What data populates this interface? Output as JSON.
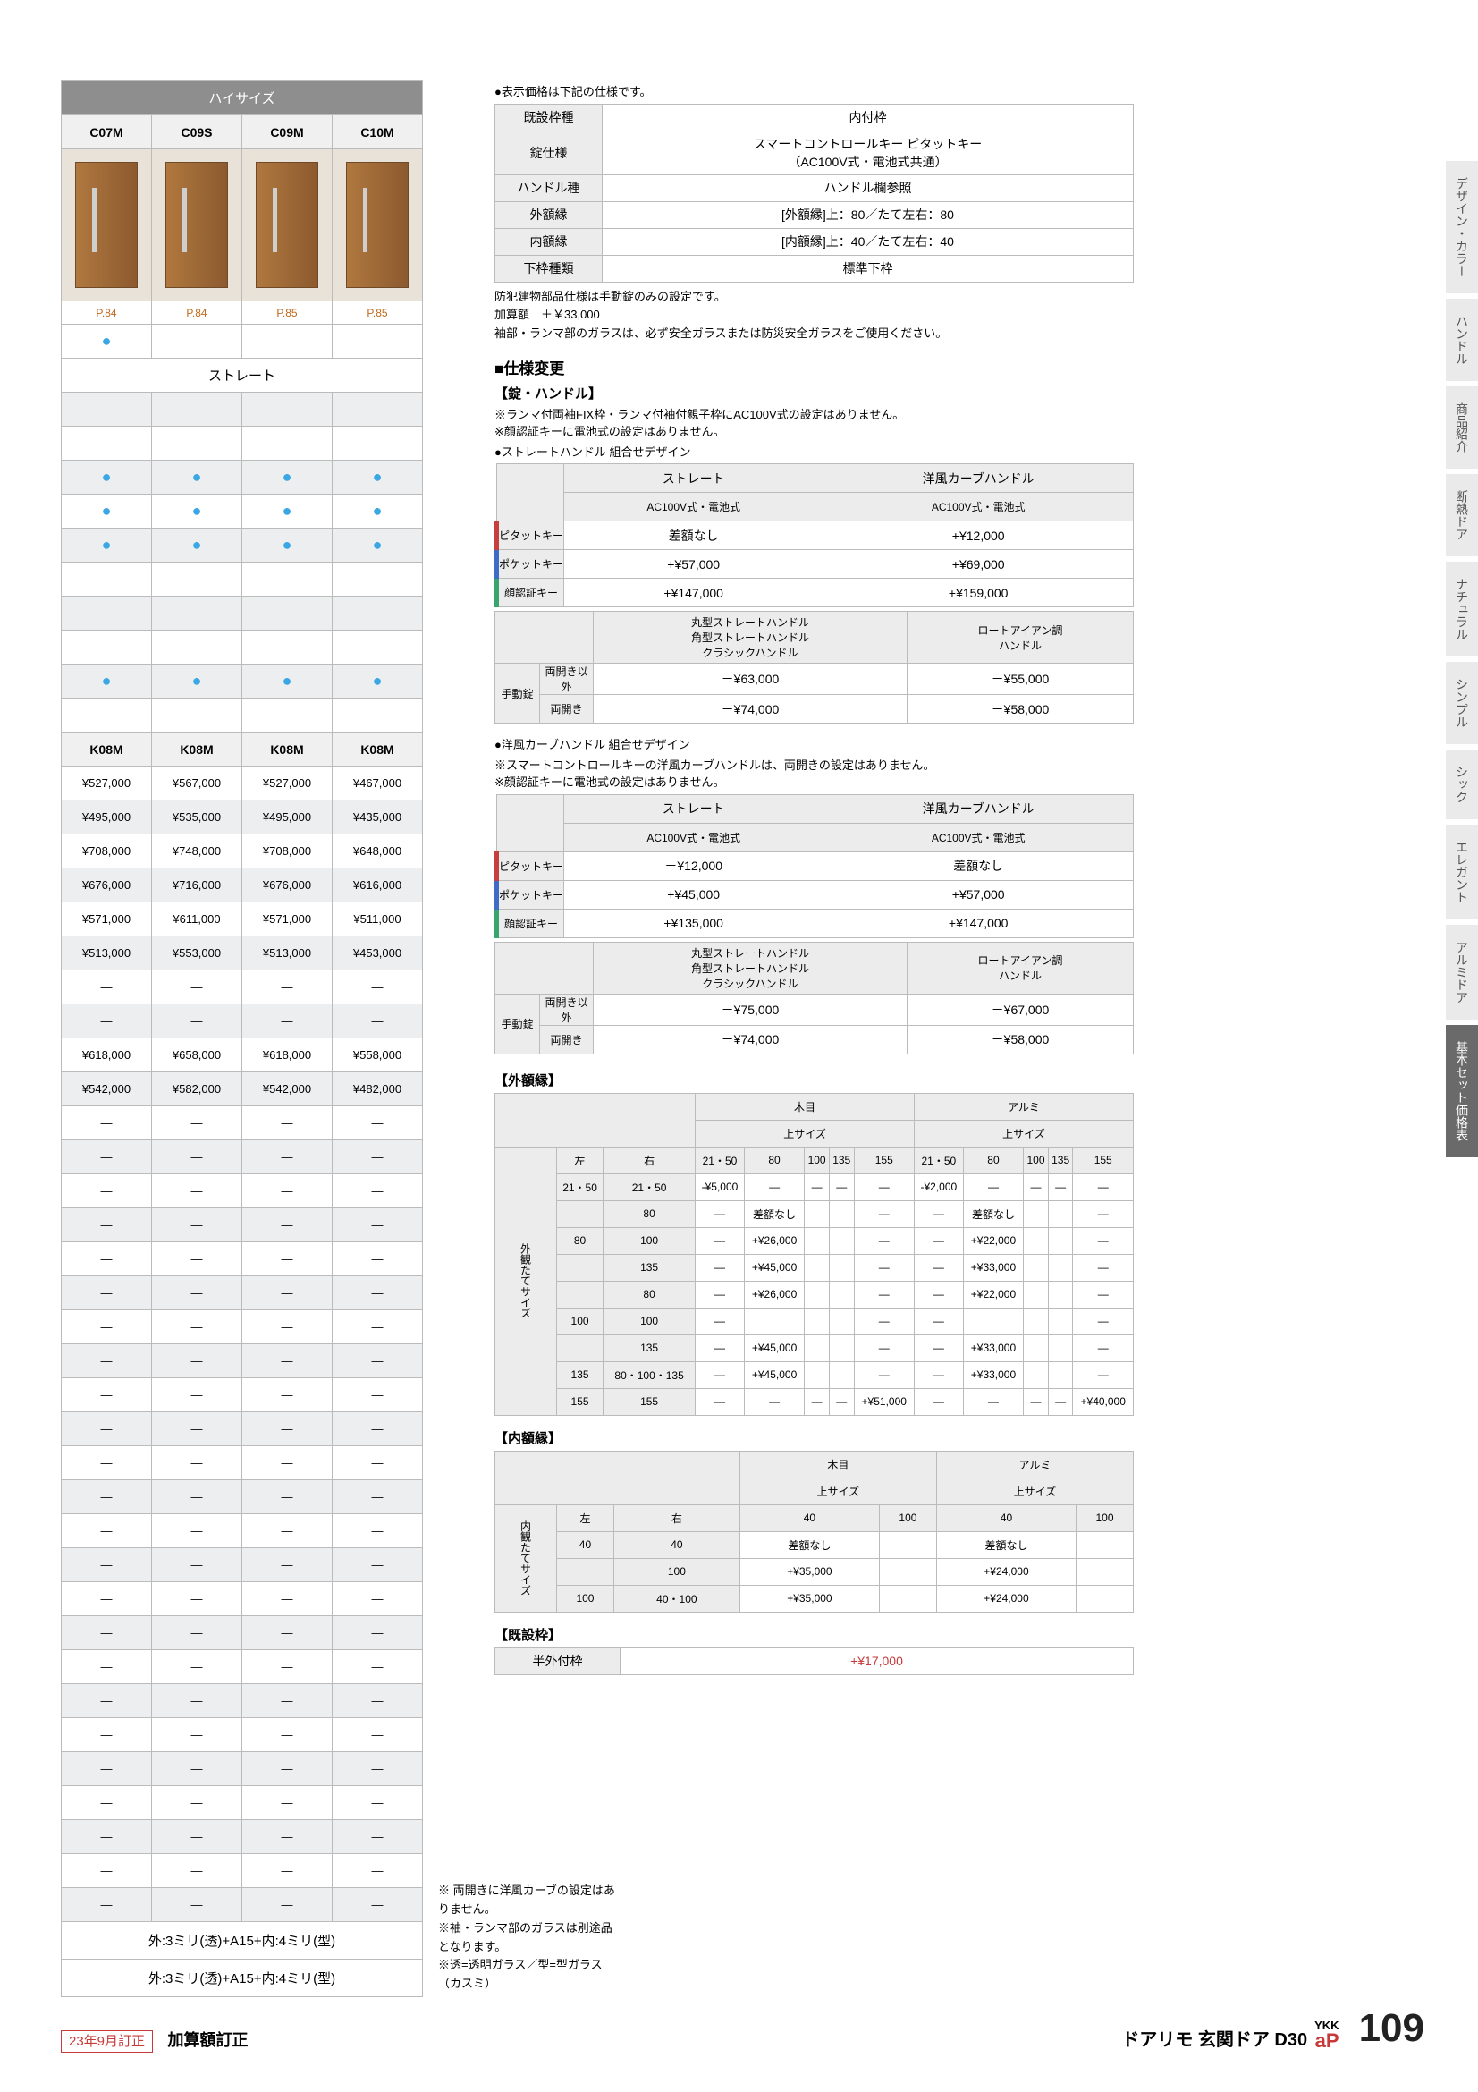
{
  "left": {
    "topHeader": "ハイサイズ",
    "models": [
      "C07M",
      "C09S",
      "C09M",
      "C10M"
    ],
    "pages": [
      "P.84",
      "P.84",
      "P.85",
      "P.85"
    ],
    "dotHeader": "ストレート",
    "handleRow": "ストレート",
    "kRow": [
      "K08M",
      "K08M",
      "K08M",
      "K08M"
    ],
    "prices": [
      [
        "¥527,000",
        "¥567,000",
        "¥527,000",
        "¥467,000"
      ],
      [
        "¥495,000",
        "¥535,000",
        "¥495,000",
        "¥435,000"
      ],
      [
        "¥708,000",
        "¥748,000",
        "¥708,000",
        "¥648,000"
      ],
      [
        "¥676,000",
        "¥716,000",
        "¥676,000",
        "¥616,000"
      ],
      [
        "¥571,000",
        "¥611,000",
        "¥571,000",
        "¥511,000"
      ],
      [
        "¥513,000",
        "¥553,000",
        "¥513,000",
        "¥453,000"
      ],
      [
        "—",
        "—",
        "—",
        "—"
      ],
      [
        "—",
        "—",
        "—",
        "—"
      ],
      [
        "¥618,000",
        "¥658,000",
        "¥618,000",
        "¥558,000"
      ],
      [
        "¥542,000",
        "¥582,000",
        "¥542,000",
        "¥482,000"
      ],
      [
        "—",
        "—",
        "—",
        "—"
      ],
      [
        "—",
        "—",
        "—",
        "—"
      ],
      [
        "—",
        "—",
        "—",
        "—"
      ],
      [
        "—",
        "—",
        "—",
        "—"
      ],
      [
        "—",
        "—",
        "—",
        "—"
      ],
      [
        "—",
        "—",
        "—",
        "—"
      ],
      [
        "—",
        "—",
        "—",
        "—"
      ],
      [
        "—",
        "—",
        "—",
        "—"
      ],
      [
        "—",
        "—",
        "—",
        "—"
      ],
      [
        "—",
        "—",
        "—",
        "—"
      ],
      [
        "—",
        "—",
        "—",
        "—"
      ],
      [
        "—",
        "—",
        "—",
        "—"
      ],
      [
        "—",
        "—",
        "—",
        "—"
      ],
      [
        "—",
        "—",
        "—",
        "—"
      ],
      [
        "—",
        "—",
        "—",
        "—"
      ],
      [
        "—",
        "—",
        "—",
        "—"
      ],
      [
        "—",
        "—",
        "—",
        "—"
      ],
      [
        "—",
        "—",
        "—",
        "—"
      ],
      [
        "—",
        "—",
        "—",
        "—"
      ],
      [
        "—",
        "—",
        "—",
        "—"
      ],
      [
        "—",
        "—",
        "—",
        "—"
      ],
      [
        "—",
        "—",
        "—",
        "—"
      ],
      [
        "—",
        "—",
        "—",
        "—"
      ],
      [
        "—",
        "—",
        "—",
        "—"
      ]
    ],
    "footnotes": [
      "外:3ミリ(透)+A15+内:4ミリ(型)",
      "外:3ミリ(透)+A15+内:4ミリ(型)"
    ],
    "midnotes": [
      "※ 両開きに洋風カーブの設定はありません。",
      "※袖・ランマ部のガラスは別途品となります。",
      "※透=透明ガラス／型=型ガラス（カスミ）"
    ]
  },
  "right": {
    "topbullet": "●表示価格は下記の仕様です。",
    "spec": [
      [
        "既設枠種",
        "内付枠"
      ],
      [
        "錠仕様",
        "スマートコントロールキー ピタットキー\n（AC100V式・電池式共通）"
      ],
      [
        "ハンドル種",
        "ハンドル欄参照"
      ],
      [
        "外額縁",
        "[外額縁]上：80／たて左右：80"
      ],
      [
        "内額縁",
        "[内額縁]上：40／たて左右：40"
      ],
      [
        "下枠種類",
        "標準下枠"
      ]
    ],
    "specnote": "防犯建物部品仕様は手動錠のみの設定です。\n加算額　＋￥33,000\n袖部・ランマ部のガラスは、必ず安全ガラスまたは防災安全ガラスをご使用ください。",
    "shiyou": "■仕様変更",
    "lockhandle": "【錠・ハンドル】",
    "locknote": "※ランマ付両袖FIX枠・ランマ付袖付親子枠にAC100V式の設定はありません。\n※顔認証キーに電池式の設定はありません。",
    "comboA": {
      "title": "●ストレートハンドル 組合せデザイン",
      "head1": [
        "ストレート",
        "洋風カーブハンドル"
      ],
      "head2": [
        "AC100V式・電池式",
        "AC100V式・電池式"
      ],
      "rows": [
        {
          "label": "ピタットキー",
          "c": "red",
          "v": [
            "差額なし",
            "+¥12,000"
          ]
        },
        {
          "label": "ポケットキー",
          "c": "blue",
          "v": [
            "+¥57,000",
            "+¥69,000"
          ]
        },
        {
          "label": "顔認証キー",
          "c": "green",
          "v": [
            "+¥147,000",
            "+¥159,000"
          ]
        }
      ],
      "head3": [
        "丸型ストレートハンドル\n角型ストレートハンドル\nクラシックハンドル",
        "ロートアイアン調\nハンドル"
      ],
      "manual": [
        {
          "l1": "手動錠",
          "l2": "両開き以外",
          "v": [
            "－¥63,000",
            "－¥55,000"
          ]
        },
        {
          "l1": "",
          "l2": "両開き",
          "v": [
            "－¥74,000",
            "－¥58,000"
          ]
        }
      ]
    },
    "comboB": {
      "title": "●洋風カーブハンドル 組合せデザイン",
      "note": "※スマートコントロールキーの洋風カーブハンドルは、両開きの設定はありません。\n※顔認証キーに電池式の設定はありません。",
      "head1": [
        "ストレート",
        "洋風カーブハンドル"
      ],
      "head2": [
        "AC100V式・電池式",
        "AC100V式・電池式"
      ],
      "rows": [
        {
          "label": "ピタットキー",
          "c": "red",
          "v": [
            "－¥12,000",
            "差額なし"
          ]
        },
        {
          "label": "ポケットキー",
          "c": "blue",
          "v": [
            "+¥45,000",
            "+¥57,000"
          ]
        },
        {
          "label": "顔認証キー",
          "c": "green",
          "v": [
            "+¥135,000",
            "+¥147,000"
          ]
        }
      ],
      "head3": [
        "丸型ストレートハンドル\n角型ストレートハンドル\nクラシックハンドル",
        "ロートアイアン調\nハンドル"
      ],
      "manual": [
        {
          "l1": "手動錠",
          "l2": "両開き以外",
          "v": [
            "－¥75,000",
            "－¥67,000"
          ]
        },
        {
          "l1": "",
          "l2": "両開き",
          "v": [
            "－¥74,000",
            "－¥58,000"
          ]
        }
      ]
    },
    "soto": {
      "title": "【外額縁】",
      "mat": [
        "木目",
        "アルミ"
      ],
      "topsize": "上サイズ",
      "cols": [
        "21・50",
        "80",
        "100",
        "135",
        "155",
        "21・50",
        "80",
        "100",
        "135",
        "155"
      ],
      "rowhead": "外観たてサイズ",
      "rows": [
        {
          "l": "21・50",
          "r": "21・50",
          "v": [
            "-¥5,000",
            "—",
            "—",
            "—",
            "—",
            "-¥2,000",
            "—",
            "—",
            "—",
            "—"
          ]
        },
        {
          "l": "",
          "r": "80",
          "v": [
            "—",
            "差額なし",
            "",
            "",
            "—",
            "—",
            "差額なし",
            "",
            "",
            "—"
          ]
        },
        {
          "l": "80",
          "r": "100",
          "v": [
            "—",
            "+¥26,000",
            "",
            "",
            "—",
            "—",
            "+¥22,000",
            "",
            "",
            "—"
          ]
        },
        {
          "l": "",
          "r": "135",
          "v": [
            "—",
            "+¥45,000",
            "",
            "",
            "—",
            "—",
            "+¥33,000",
            "",
            "",
            "—"
          ]
        },
        {
          "l": "",
          "r": "80",
          "v": [
            "—",
            "+¥26,000",
            "",
            "",
            "—",
            "—",
            "+¥22,000",
            "",
            "",
            "—"
          ]
        },
        {
          "l": "100",
          "r": "100",
          "v": [
            "—",
            "",
            "",
            "",
            "—",
            "—",
            "",
            "",
            "",
            "—"
          ]
        },
        {
          "l": "",
          "r": "135",
          "v": [
            "—",
            "+¥45,000",
            "",
            "",
            "—",
            "—",
            "+¥33,000",
            "",
            "",
            "—"
          ]
        },
        {
          "l": "135",
          "r": "80・100・135",
          "v": [
            "—",
            "+¥45,000",
            "",
            "",
            "—",
            "—",
            "+¥33,000",
            "",
            "",
            "—"
          ]
        },
        {
          "l": "155",
          "r": "155",
          "v": [
            "—",
            "—",
            "—",
            "—",
            "+¥51,000",
            "—",
            "—",
            "—",
            "—",
            "+¥40,000"
          ]
        }
      ],
      "side": [
        "左",
        "右"
      ]
    },
    "uchi": {
      "title": "【内額縁】",
      "mat": [
        "木目",
        "アルミ"
      ],
      "topsize": "上サイズ",
      "cols": [
        "40",
        "100",
        "40",
        "100"
      ],
      "rowhead": "内観たてサイズ",
      "rows": [
        {
          "l": "40",
          "r": "40",
          "v": [
            "差額なし",
            "",
            "差額なし",
            ""
          ]
        },
        {
          "l": "",
          "r": "100",
          "v": [
            "+¥35,000",
            "",
            "+¥24,000",
            ""
          ]
        },
        {
          "l": "100",
          "r": "40・100",
          "v": [
            "+¥35,000",
            "",
            "+¥24,000",
            ""
          ]
        }
      ],
      "side": [
        "左",
        "右"
      ]
    },
    "kisetsu": {
      "title": "【既設枠】",
      "label": "半外付枠",
      "value": "+¥17,000"
    }
  },
  "tabs": [
    "デザイン・カラー",
    "ハンドル",
    "商品紹介",
    "断熱ドア",
    "ナチュラル",
    "シンプル",
    "シック",
    "エレガント",
    "アルミドア",
    "基本セット価格表"
  ],
  "tabActive": 9,
  "footer": {
    "rev": "23年9月訂正",
    "revlabel": "加算額訂正",
    "title": "ドアリモ 玄関ドア D30",
    "brand": "YKK",
    "ap": "aP",
    "page": "109"
  }
}
